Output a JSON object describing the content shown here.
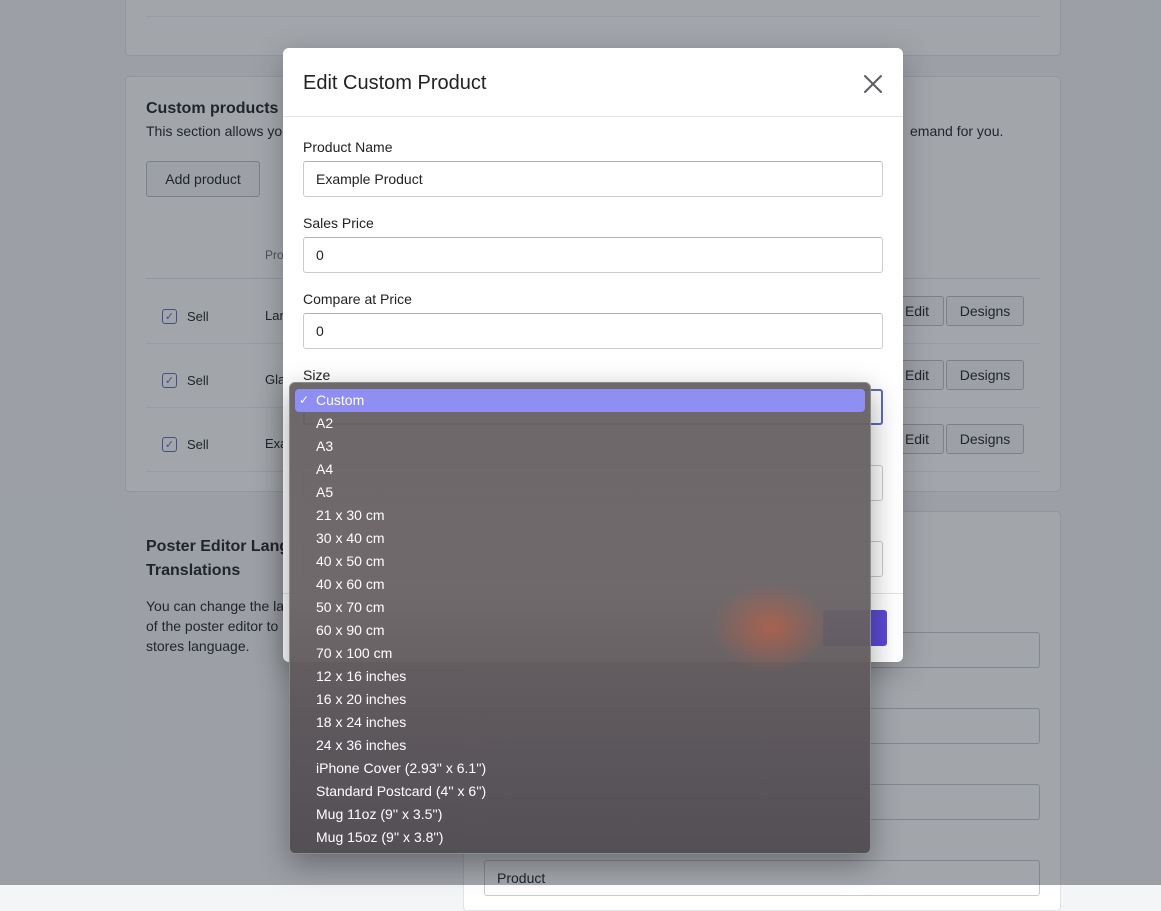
{
  "custom_products": {
    "title": "Custom products",
    "description_start": "This section allows yo",
    "description_end": "emand for you.",
    "add_button": "Add product",
    "column_header_partial": "Pro",
    "rows": [
      {
        "sell_label": "Sell",
        "name_partial": "Lar",
        "edit_label": "Edit",
        "designs_label": "Designs"
      },
      {
        "sell_label": "Sell",
        "name_partial": "Gla",
        "edit_label": "Edit",
        "designs_label": "Designs"
      },
      {
        "sell_label": "Sell",
        "name_partial": "Exa",
        "edit_label": "Edit",
        "designs_label": "Designs"
      }
    ]
  },
  "poster_editor": {
    "title_line1": "Poster Editor Lang",
    "title_line2": "Translations",
    "desc_line1": "You can change the la",
    "desc_line2": "of the poster editor to",
    "desc_line3": "stores language.",
    "last_field_value": "Product"
  },
  "modal": {
    "title": "Edit Custom Product",
    "close_icon": "close-icon",
    "fields": {
      "product_name_label": "Product Name",
      "product_name_value": "Example Product",
      "sales_price_label": "Sales Price",
      "sales_price_value": "0",
      "compare_price_label": "Compare at Price",
      "compare_price_value": "0",
      "size_label": "Size"
    }
  },
  "size_dropdown": {
    "selected": "Custom",
    "options": [
      "Custom",
      "A2",
      "A3",
      "A4",
      "A5",
      "21 x 30 cm",
      "30 x 40 cm",
      "40 x 50 cm",
      "40 x 60 cm",
      "50 x 70 cm",
      "60 x 90 cm",
      "70 x 100 cm",
      "12 x 16 inches",
      "16 x 20 inches",
      "18 x 24 inches",
      "24 x 36 inches",
      "iPhone Cover (2.93'' x 6.1'')",
      "Standard Postcard (4'' x 6'')",
      "Mug 11oz (9'' x 3.5'')",
      "Mug 15oz (9'' x 3.8'')"
    ]
  },
  "colors": {
    "accent": "#5c6ac4",
    "primary_button": "#5c4ad4",
    "selected_option": "#8e8ef3"
  }
}
